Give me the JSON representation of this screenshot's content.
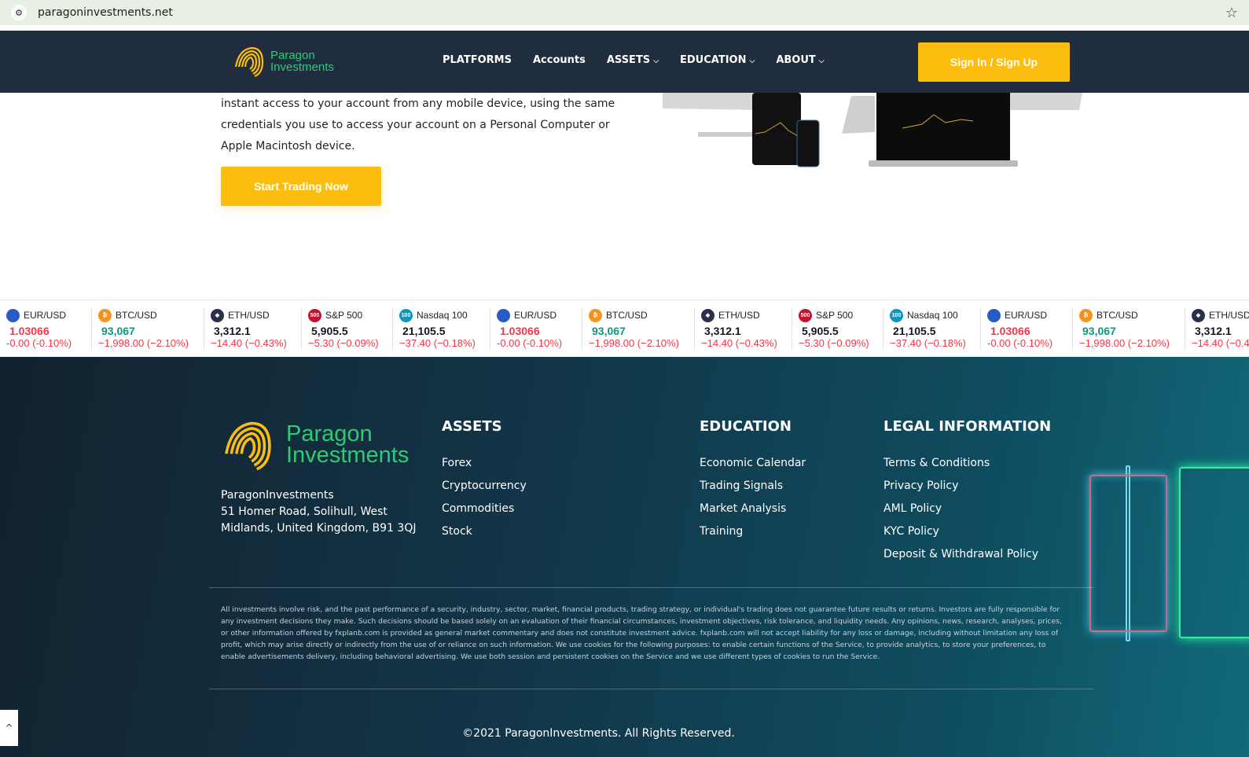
{
  "browser": {
    "url": "paragoninvestments.net"
  },
  "brand": {
    "line1": "Paragon",
    "line2": "Investments",
    "gold": "#fdbd0f",
    "green": "#2fcb74"
  },
  "nav": {
    "items": [
      {
        "label": "PLATFORMS"
      },
      {
        "label": "Accounts"
      },
      {
        "label": "ASSETS"
      },
      {
        "label": "EDUCATION"
      },
      {
        "label": "ABOUT"
      }
    ],
    "signin": "Sign In / Sign Up"
  },
  "hero": {
    "text": "instant access to your account from any mobile device, using the same credentials you use to access your account on a Personal Computer or Apple Macintosh device.",
    "cta": "Start Trading Now"
  },
  "ticker": [
    {
      "name": "EUR/USD",
      "price": "1.03066",
      "change": "-0.00 (-0.10%)",
      "price_color": "#f23645",
      "icon": "eu-us-flag-icon",
      "icon_color": "#2a5ac8",
      "icon_text": ""
    },
    {
      "name": "BTC/USD",
      "price": "93,067",
      "change": "−1,998.00 (−2.10%)",
      "price_color": "#089981",
      "icon": "bitcoin-icon",
      "icon_color": "#f7931a",
      "icon_text": "₿"
    },
    {
      "name": "ETH/USD",
      "price": "3,312.1",
      "change": "−14.40 (−0.43%)",
      "price_color": "#131722",
      "icon": "ethereum-icon",
      "icon_color": "#2b2f48",
      "icon_text": "◆"
    },
    {
      "name": "S&P 500",
      "price": "5,905.5",
      "change": "−5.30 (−0.09%)",
      "price_color": "#131722",
      "icon": "sp500-icon",
      "icon_color": "#c8102e",
      "icon_text": "500"
    },
    {
      "name": "Nasdaq 100",
      "price": "21,105.5",
      "change": "−37.40 (−0.18%)",
      "price_color": "#131722",
      "icon": "nasdaq-icon",
      "icon_color": "#0f95c2",
      "icon_text": "100"
    }
  ],
  "footer": {
    "address": [
      "ParagonInvestments",
      "51 Homer Road, Solihull, West",
      "Midlands, United Kingdom, B91 3QJ"
    ],
    "assets": {
      "title": "ASSETS",
      "links": [
        "Forex",
        "Cryptocurrency",
        "Commodities",
        "Stock"
      ]
    },
    "education": {
      "title": "EDUCATION",
      "links": [
        "Economic Calendar",
        "Trading Signals",
        "Market Analysis",
        "Training"
      ]
    },
    "legal": {
      "title": "LEGAL INFORMATION",
      "links": [
        "Terms & Conditions",
        "Privacy Policy",
        "AML Policy",
        "KYC Policy",
        "Deposit & Withdrawal Policy"
      ]
    },
    "disclaimer": "All investments involve risk, and the past performance of a security, industry, sector, market, financial products, trading strategy, or individual's trading does not guarantee future results or returns. Investors are fully responsible for any investment decisions they make. Such decisions should be based solely on an evaluation of their financial circumstances, investment objectives, risk tolerance, and liquidity needs. Any opinions, news, research, analyses, prices, or other information offered by fxplanb.com is provided as general market commentary and does not constitute investment advice. fxplanb.com will not accept liability for any loss or damage, including without limitation any loss of profit, which may arise directly or indirectly from the use of or reliance on such information. We use cookies for the following purposes: to enable certain functions of the Service, to provide analytics, to store your preferences, to enable advertisements delivery, including behavioral advertising. We use both session and persistent cookies on the Service and we use different types of cookies to run the Service.",
    "copyright": "©2021 ParagonInvestments. All Rights Reserved."
  }
}
